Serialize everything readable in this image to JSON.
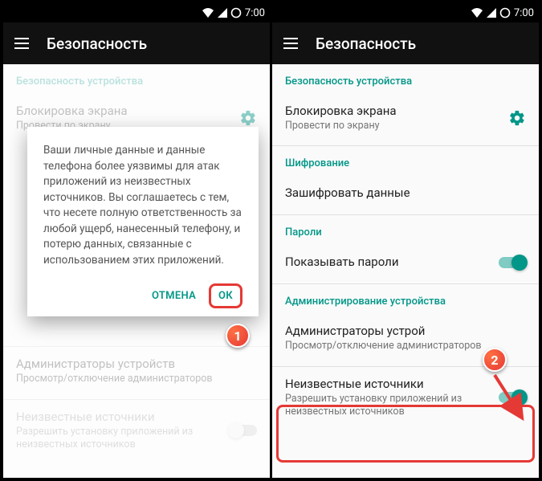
{
  "status": {
    "time": "7:00"
  },
  "appbar": {
    "title": "Безопасность"
  },
  "sections": {
    "device_security": "Безопасность устройства",
    "encryption": "Шифрование",
    "passwords": "Пароли",
    "device_admin": "Администрирование устройства"
  },
  "items": {
    "screen_lock": {
      "title": "Блокировка экрана",
      "sub": "Провести по экрану"
    },
    "encrypt": {
      "title": "Зашифровать данные"
    },
    "show_passwords": {
      "title": "Показывать пароли"
    },
    "device_admins_full": {
      "title": "Администраторы устройств",
      "sub": "Просмотр/отключение администраторов"
    },
    "device_admins_trim": {
      "title": "Администраторы устрой",
      "sub": "Просмотр/отключение администраторов"
    },
    "unknown_sources": {
      "title": "Неизвестные источники",
      "sub": "Разрешить установку приложений из неизвестных источников"
    }
  },
  "dialog": {
    "text": "Ваши личные данные и данные телефона более уязвимы для атак приложений из неизвестных источников. Вы соглашаетесь с тем, что несете полную ответственность за любой ущерб, нанесенный телефону, и потерю данных, связанные с использованием этих приложений.",
    "cancel": "ОТМЕНА",
    "ok": "ОК"
  },
  "badges": {
    "one": "1",
    "two": "2"
  }
}
